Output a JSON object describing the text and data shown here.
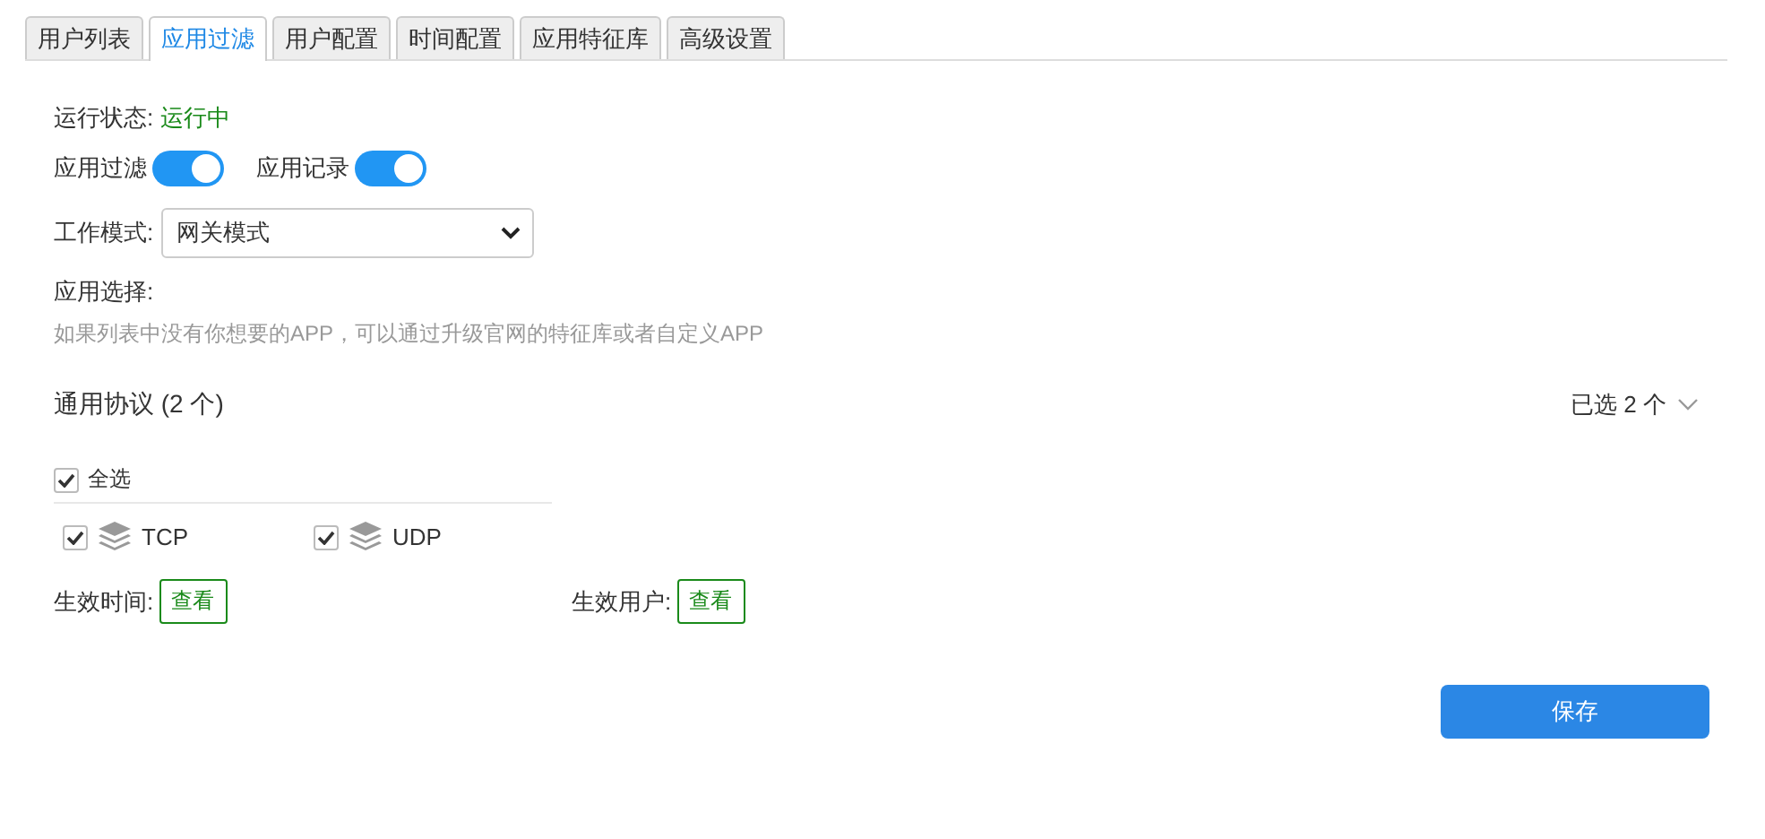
{
  "tabs": [
    {
      "label": "用户列表",
      "selected": false
    },
    {
      "label": "应用过滤",
      "selected": true
    },
    {
      "label": "用户配置",
      "selected": false
    },
    {
      "label": "时间配置",
      "selected": false
    },
    {
      "label": "应用特征库",
      "selected": false
    },
    {
      "label": "高级设置",
      "selected": false
    }
  ],
  "status": {
    "label": "运行状态:",
    "value": "运行中"
  },
  "toggles": [
    {
      "label": "应用过滤",
      "on": true
    },
    {
      "label": "应用记录",
      "on": true
    }
  ],
  "work_mode": {
    "label": "工作模式:",
    "value": "网关模式"
  },
  "app_select": {
    "label": "应用选择:",
    "hint": "如果列表中没有你想要的APP，可以通过升级官网的特征库或者自定义APP"
  },
  "group": {
    "title": "通用协议 (2 个)",
    "summary": "已选 2 个",
    "select_all": {
      "label": "全选",
      "checked": true
    },
    "protocols": [
      {
        "name": "TCP",
        "checked": true
      },
      {
        "name": "UDP",
        "checked": true
      }
    ]
  },
  "effect": [
    {
      "label": "生效时间:",
      "button": "查看"
    },
    {
      "label": "生效用户:",
      "button": "查看"
    }
  ],
  "save_button": "保存"
}
